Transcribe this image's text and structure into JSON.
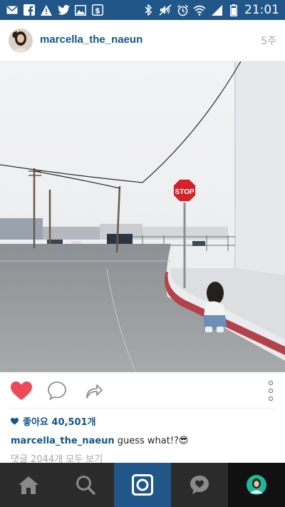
{
  "status_bar": {
    "time": "21:01",
    "left_icons": [
      "mail-icon",
      "facebook-icon",
      "warning-icon",
      "twitter-icon",
      "gallery-icon",
      "stock-app-icon"
    ],
    "right_icons": [
      "bluetooth-icon",
      "mute-icon",
      "alarm-icon",
      "wifi-icon",
      "signal-icon",
      "battery-icon"
    ],
    "bar_color": "#215788"
  },
  "post": {
    "username": "marcella_the_naeun",
    "time_ago": "5주",
    "photo_sign_text": "STOP",
    "liked": true,
    "likes_text": "좋아요 40,501개",
    "caption_user": "marcella_the_naeun",
    "caption_text": "guess what!?😎",
    "comments_text": "댓글 2044개 모두 보기"
  },
  "colors": {
    "link": "#125688",
    "like": "#ed4956",
    "muted": "#a5a7aa",
    "nav_bg": "#2b2b2b"
  },
  "nav": {
    "items": [
      "home-icon",
      "search-icon",
      "camera-icon",
      "activity-icon",
      "profile-icon"
    ],
    "active": "camera-icon"
  }
}
